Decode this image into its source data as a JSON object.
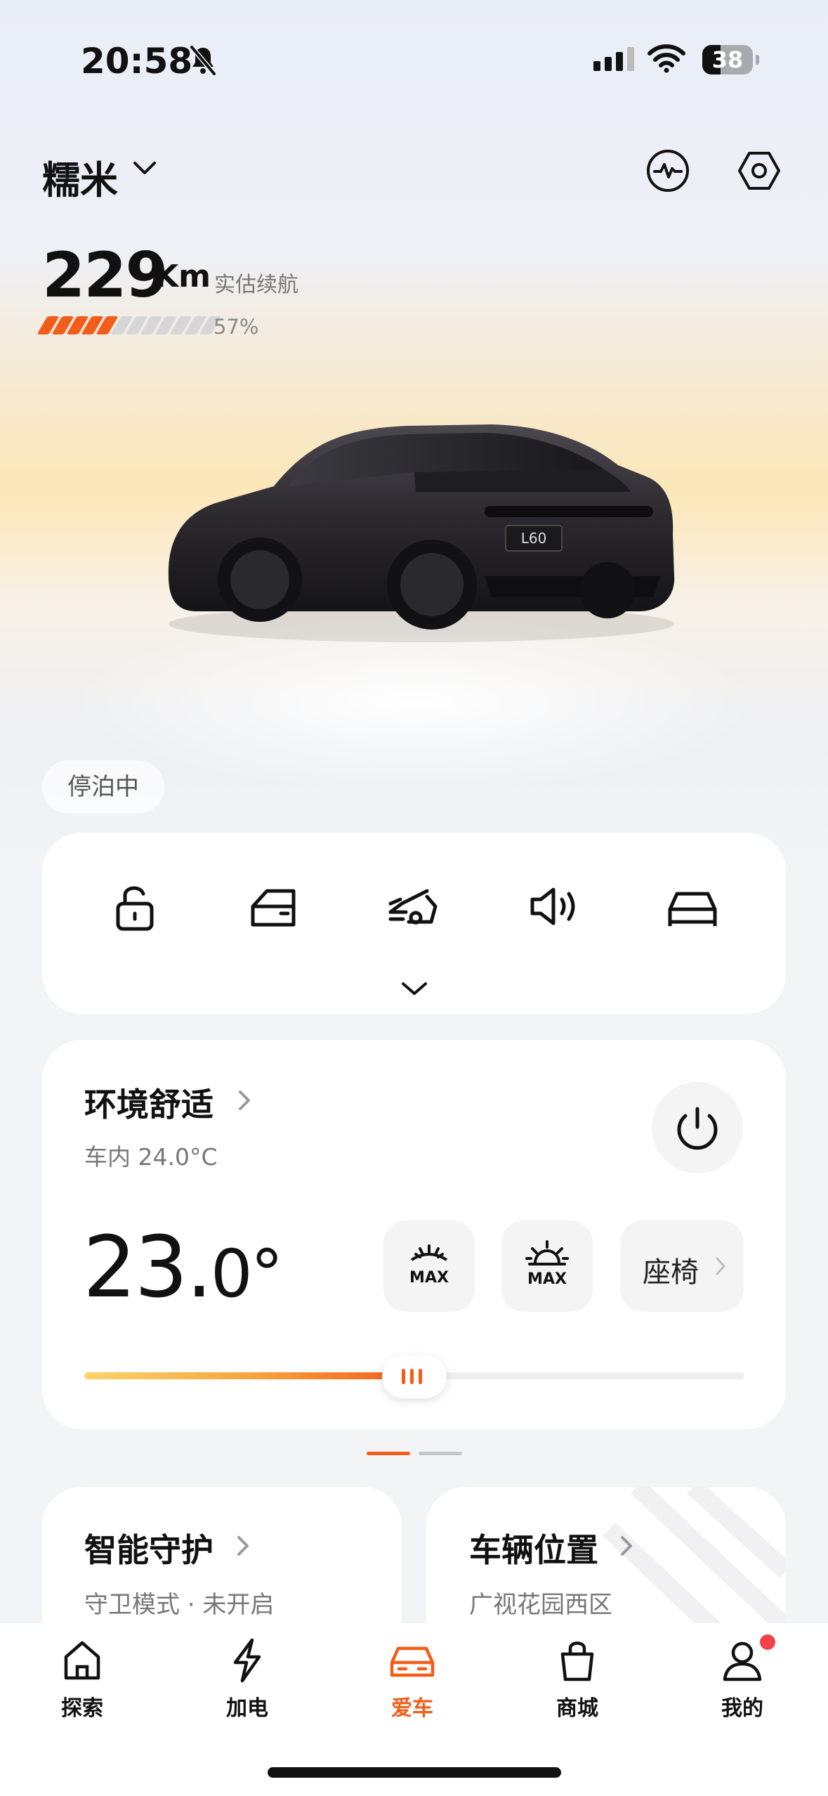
{
  "status_bar": {
    "time": "20:58",
    "battery": "38"
  },
  "header": {
    "car_name": "糯米"
  },
  "range": {
    "value": "229",
    "unit": "Km",
    "label": "实估续航",
    "battery_percent": "57%",
    "battery_level": 0.57
  },
  "vehicle": {
    "model_badge": "L60",
    "state": "停泊中"
  },
  "quick_controls": [
    "lock-icon",
    "door-icon",
    "trunk-icon",
    "horn-icon",
    "car-icon"
  ],
  "comfort": {
    "title": "环境舒适",
    "cabin_temp": "车内 24.0°C",
    "set_temp_main": "23.",
    "set_temp_decimal": "0°",
    "defrost_front": "MAX",
    "defrost_rear": "MAX",
    "seat": "座椅",
    "temp_level": 0.5
  },
  "cards": {
    "guard": {
      "title": "智能守护",
      "sub": "守卫模式 · 未开启"
    },
    "location": {
      "title": "车辆位置",
      "sub": "广视花园西区"
    }
  },
  "tabs": [
    {
      "label": "探索",
      "icon": "home-icon"
    },
    {
      "label": "加电",
      "icon": "lightning-icon"
    },
    {
      "label": "爱车",
      "icon": "car-icon"
    },
    {
      "label": "商城",
      "icon": "shopping-bag-icon"
    },
    {
      "label": "我的",
      "icon": "profile-icon"
    }
  ],
  "colors": {
    "accent": "#f25d19",
    "badge": "#f4414a"
  }
}
